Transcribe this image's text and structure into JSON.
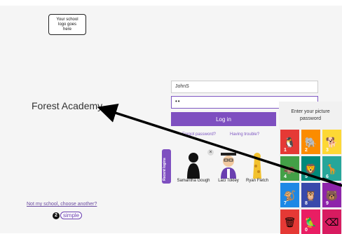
{
  "logo": {
    "line1": "Your school",
    "line2": "logo goes",
    "line3": "here"
  },
  "school": {
    "name": "Forest Academy",
    "change_link": "Not my school, choose another?"
  },
  "brand": {
    "mark": "2",
    "word": "simple"
  },
  "login": {
    "username_value": "JohnS",
    "password_value": "••",
    "login_label": "Log in",
    "forgot_label": "Forgot password?",
    "trouble_label": "Having trouble?"
  },
  "recent": {
    "tab_label": "Recent logins",
    "users": [
      {
        "name": "Samantha Gough"
      },
      {
        "name": "Laci Tokley"
      },
      {
        "name": "Ryan Fletch"
      }
    ]
  },
  "picture_password": {
    "title_line1": "Enter your picture",
    "title_line2": "password",
    "tiles": [
      {
        "num": "1",
        "icon": "penguin-icon",
        "glyph": "🐧",
        "color": "#e53935"
      },
      {
        "num": "2",
        "icon": "elephant-icon",
        "glyph": "🐘",
        "color": "#fb8c00"
      },
      {
        "num": "3",
        "icon": "dog-icon",
        "glyph": "🐕",
        "color": "#fdd835"
      },
      {
        "num": "4",
        "icon": "hippo-icon",
        "glyph": "🦛",
        "color": "#43a047"
      },
      {
        "num": "5",
        "icon": "lion-icon",
        "glyph": "🦁",
        "color": "#00897b"
      },
      {
        "num": "6",
        "icon": "giraffe-icon",
        "glyph": "🦒",
        "color": "#26a69a"
      },
      {
        "num": "7",
        "icon": "monkey-icon",
        "glyph": "🐒",
        "color": "#1e88e5"
      },
      {
        "num": "8",
        "icon": "owl-icon",
        "glyph": "🦉",
        "color": "#3949ab"
      },
      {
        "num": "9",
        "icon": "bear-icon",
        "glyph": "🐻",
        "color": "#8e24aa"
      },
      {
        "num": "",
        "icon": "trash-icon",
        "glyph": "🗑",
        "color": "#e53935"
      },
      {
        "num": "0",
        "icon": "parrot-icon",
        "glyph": "🦜",
        "color": "#e91e63"
      },
      {
        "num": "",
        "icon": "backspace-icon",
        "glyph": "⌫",
        "color": "#d81b60"
      }
    ]
  }
}
